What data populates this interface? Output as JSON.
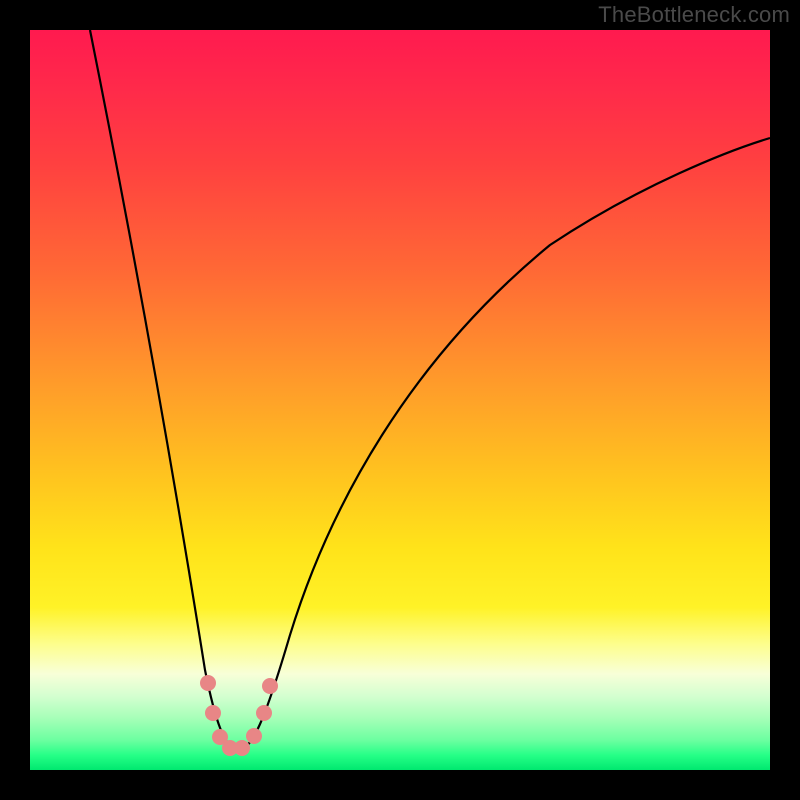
{
  "attribution": "TheBottleneck.com",
  "chart_data": {
    "type": "line",
    "title": "",
    "xlabel": "",
    "ylabel": "",
    "xlim": [
      0,
      740
    ],
    "ylim": [
      0,
      740
    ],
    "grid": false,
    "series": [
      {
        "name": "bottleneck-curve",
        "x": [
          60,
          80,
          100,
          120,
          140,
          160,
          175,
          185,
          195,
          205,
          215,
          225,
          240,
          260,
          280,
          310,
          350,
          400,
          460,
          530,
          610,
          700,
          740
        ],
        "y": [
          0,
          130,
          260,
          380,
          490,
          580,
          640,
          680,
          710,
          720,
          715,
          700,
          665,
          605,
          548,
          478,
          405,
          338,
          278,
          225,
          178,
          138,
          122
        ],
        "note": "y measured from top edge of plot (0 at top, 740 at bottom); curve descends steeply from upper-left, bottoms out near x≈205 close to the green band, then rises toward upper-right with gentler slope"
      }
    ],
    "markers": {
      "name": "highlighted-points",
      "color": "#e98080",
      "points": [
        {
          "x": 178,
          "y": 653
        },
        {
          "x": 183,
          "y": 683
        },
        {
          "x": 190,
          "y": 707
        },
        {
          "x": 200,
          "y": 718
        },
        {
          "x": 212,
          "y": 718
        },
        {
          "x": 224,
          "y": 706
        },
        {
          "x": 234,
          "y": 683
        },
        {
          "x": 240,
          "y": 656
        }
      ]
    },
    "gradient_scale": {
      "direction": "vertical",
      "meaning": "red (top) = high bottleneck, green (bottom) = no bottleneck",
      "stops": [
        "#ff1a4f",
        "#ff6a35",
        "#ffc31f",
        "#fdfe8d",
        "#00e86f"
      ]
    }
  }
}
